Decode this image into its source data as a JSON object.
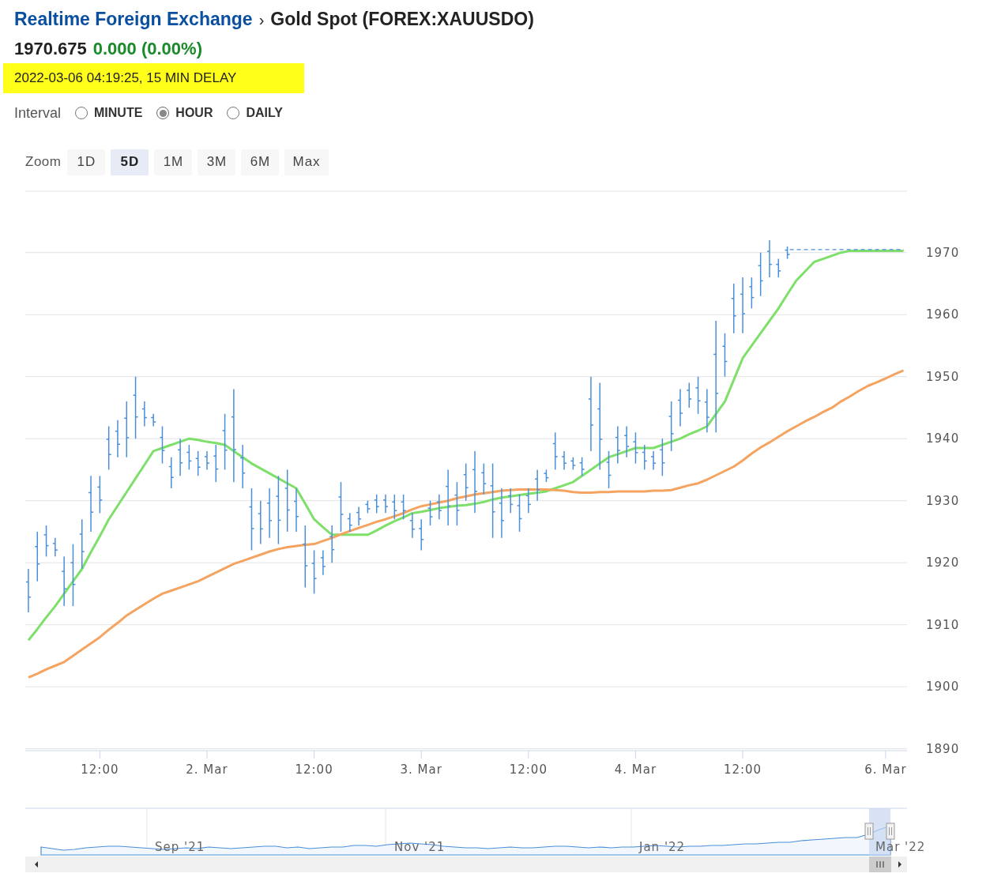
{
  "breadcrumb": {
    "link": "Realtime Foreign Exchange",
    "separator": "›",
    "title": "Gold Spot (FOREX:XAUUSDO)"
  },
  "quote": {
    "price": "1970.675",
    "change": "0.000 (0.00%)",
    "timestamp": "2022-03-06 04:19:25, 15 MIN DELAY"
  },
  "interval": {
    "label": "Interval",
    "options": [
      {
        "label": "MINUTE",
        "selected": false
      },
      {
        "label": "HOUR",
        "selected": true
      },
      {
        "label": "DAILY",
        "selected": false
      }
    ]
  },
  "zoom": {
    "label": "Zoom",
    "buttons": [
      {
        "label": "1D",
        "selected": false
      },
      {
        "label": "5D",
        "selected": true
      },
      {
        "label": "1M",
        "selected": false
      },
      {
        "label": "3M",
        "selected": false
      },
      {
        "label": "6M",
        "selected": false
      },
      {
        "label": "Max",
        "selected": false
      }
    ]
  },
  "chart": {
    "chart_data": {
      "type": "line",
      "categories": [
        null,
        null,
        null,
        null,
        null,
        null,
        null,
        null,
        "12:00",
        null,
        null,
        null,
        null,
        null,
        null,
        null,
        null,
        null,
        null,
        null,
        "2. Mar",
        null,
        null,
        null,
        null,
        null,
        null,
        null,
        null,
        null,
        null,
        null,
        "12:00",
        null,
        null,
        null,
        null,
        null,
        null,
        null,
        null,
        null,
        null,
        null,
        "3. Mar",
        null,
        null,
        null,
        null,
        null,
        null,
        null,
        null,
        null,
        null,
        null,
        "12:00",
        null,
        null,
        null,
        null,
        null,
        null,
        null,
        null,
        null,
        null,
        null,
        "4. Mar",
        null,
        null,
        null,
        null,
        null,
        null,
        null,
        null,
        null,
        null,
        null,
        "12:00",
        null,
        null,
        null,
        null,
        null,
        null,
        null,
        null,
        null,
        null,
        null,
        null,
        null,
        null,
        null,
        "6. Mar",
        null,
        null
      ],
      "ylim": [
        1889.7,
        1979.9
      ],
      "grid": true,
      "yticks": [
        1890,
        1900,
        1910,
        1920,
        1930,
        1940,
        1950,
        1960,
        1970
      ],
      "series": [
        {
          "color": "#7ee06a",
          "values": [
            1907.5,
            1909.3,
            1911.2,
            1913,
            1915,
            1917,
            1919,
            1921.7,
            1924.3,
            1927,
            1929.2,
            1931.4,
            1933.6,
            1935.8,
            1938,
            1938.5,
            1939,
            1939.5,
            1940,
            1939.8,
            1939.5,
            1939.3,
            1939,
            1938,
            1937,
            1936,
            1935.2,
            1934.4,
            1933.6,
            1932.8,
            1932,
            1929.5,
            1927,
            1925.7,
            1924.5,
            1924.5,
            1924.5,
            1924.5,
            1924.5,
            1925.2,
            1926,
            1926.7,
            1927.3,
            1928,
            1928.2,
            1928.5,
            1928.8,
            1929,
            1929.2,
            1929.3,
            1929.5,
            1929.8,
            1930.2,
            1930.5,
            1930.7,
            1930.9,
            1931.1,
            1931.3,
            1931.5,
            1932,
            1932.5,
            1933,
            1934,
            1935,
            1936,
            1937,
            1937.5,
            1938,
            1938.5,
            1938.5,
            1938.5,
            1939,
            1939.5,
            1940,
            1940.7,
            1941.3,
            1942,
            1944,
            1946,
            1949.5,
            1953,
            1955,
            1957,
            1959,
            1961,
            1963.3,
            1965.5,
            1967,
            1968.5,
            1969,
            1969.5,
            1970,
            1970.3,
            1970.3,
            1970.3,
            1970.3,
            1970.3,
            1970.3,
            1970.3
          ]
        },
        {
          "color": "#f4a460",
          "values": [
            1901.5,
            1902.1,
            1902.8,
            1903.4,
            1904,
            1905,
            1906,
            1907,
            1908,
            1909.2,
            1910.3,
            1911.5,
            1912.4,
            1913.3,
            1914.2,
            1915,
            1915.5,
            1916,
            1916.5,
            1917,
            1917.7,
            1918.4,
            1919.1,
            1919.8,
            1920.3,
            1920.8,
            1921.3,
            1921.8,
            1922.2,
            1922.5,
            1922.7,
            1922.9,
            1923,
            1923.5,
            1924,
            1924.6,
            1925.1,
            1925.6,
            1926.1,
            1926.6,
            1927,
            1927.5,
            1928,
            1928.6,
            1929.1,
            1929.4,
            1929.7,
            1930,
            1930.4,
            1930.7,
            1931,
            1931.2,
            1931.4,
            1931.6,
            1931.7,
            1931.8,
            1931.8,
            1931.8,
            1931.8,
            1931.7,
            1931.6,
            1931.4,
            1931.3,
            1931.3,
            1931.4,
            1931.4,
            1931.5,
            1931.5,
            1931.5,
            1931.5,
            1931.6,
            1931.6,
            1931.7,
            1932.1,
            1932.5,
            1932.8,
            1933.4,
            1934.1,
            1934.8,
            1935.5,
            1936.5,
            1937.6,
            1938.6,
            1939.4,
            1940.3,
            1941.2,
            1942,
            1942.8,
            1943.5,
            1944.3,
            1945,
            1946,
            1946.8,
            1947.7,
            1948.5,
            1949.1,
            1949.7,
            1950.4,
            1951
          ]
        }
      ]
    }
  },
  "navigator": {
    "labels": [
      "Sep '21",
      "Nov '21",
      "Jan '22",
      "Mar '22"
    ]
  }
}
